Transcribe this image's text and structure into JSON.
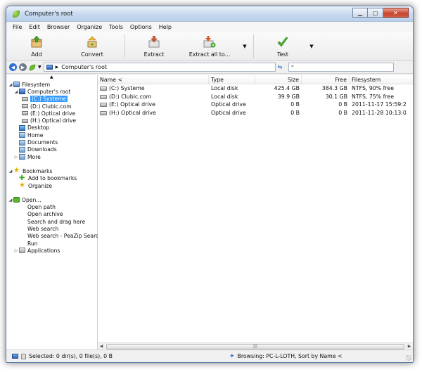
{
  "window": {
    "title": "Computer's root"
  },
  "menu": [
    "File",
    "Edit",
    "Browser",
    "Organize",
    "Tools",
    "Options",
    "Help"
  ],
  "toolbar": {
    "add": "Add",
    "convert": "Convert",
    "extract": "Extract",
    "extract_all": "Extract all to...",
    "test": "Test"
  },
  "address": {
    "path": "Computer's root",
    "search_placeholder": "*"
  },
  "tree": {
    "filesystem": "Filesystem",
    "computer_root": "Computer's root",
    "drive_c": "(C:) Systeme",
    "drive_d": "(D:) Clubic.com",
    "drive_e": "(E:) Optical drive",
    "drive_h": "(H:) Optical drive",
    "desktop": "Desktop",
    "home": "Home",
    "documents": "Documents",
    "downloads": "Downloads",
    "more": "More",
    "bookmarks": "Bookmarks",
    "add_bookmarks": "Add to bookmarks",
    "organize": "Organize",
    "open": "Open...",
    "open_path": "Open path",
    "open_archive": "Open archive",
    "search_drag": "Search and drag here",
    "web_search": "Web search",
    "web_search_peazip": "Web search - PeaZip Search",
    "run": "Run",
    "applications": "Applications"
  },
  "columns": {
    "name": "Name <",
    "type": "Type",
    "size": "Size",
    "free": "Free",
    "filesystem": "Filesystem"
  },
  "rows": [
    {
      "name": "(C:) Systeme",
      "type": "Local disk",
      "size": "425.4 GB",
      "free": "384.3 GB",
      "fs": "NTFS, 90% free"
    },
    {
      "name": "(D:) Clubic.com",
      "type": "Local disk",
      "size": "39.9 GB",
      "free": "30.1 GB",
      "fs": "NTFS, 75% free"
    },
    {
      "name": "(E:) Optical drive",
      "type": "Optical drive",
      "size": "0 B",
      "free": "0 B",
      "fs": "2011-11-17 15:59:26"
    },
    {
      "name": "(H:) Optical drive",
      "type": "Optical drive",
      "size": "0 B",
      "free": "0 B",
      "fs": "2011-11-28 10:13:02"
    }
  ],
  "status": {
    "selected": "Selected: 0 dir(s), 0 file(s), 0 B",
    "browsing": "Browsing: PC-L-LOTH, Sort by Name <"
  },
  "colors": {
    "selection": "#3399ff",
    "title_gradient": "#c7d9ef",
    "close_button": "#c7432d"
  }
}
